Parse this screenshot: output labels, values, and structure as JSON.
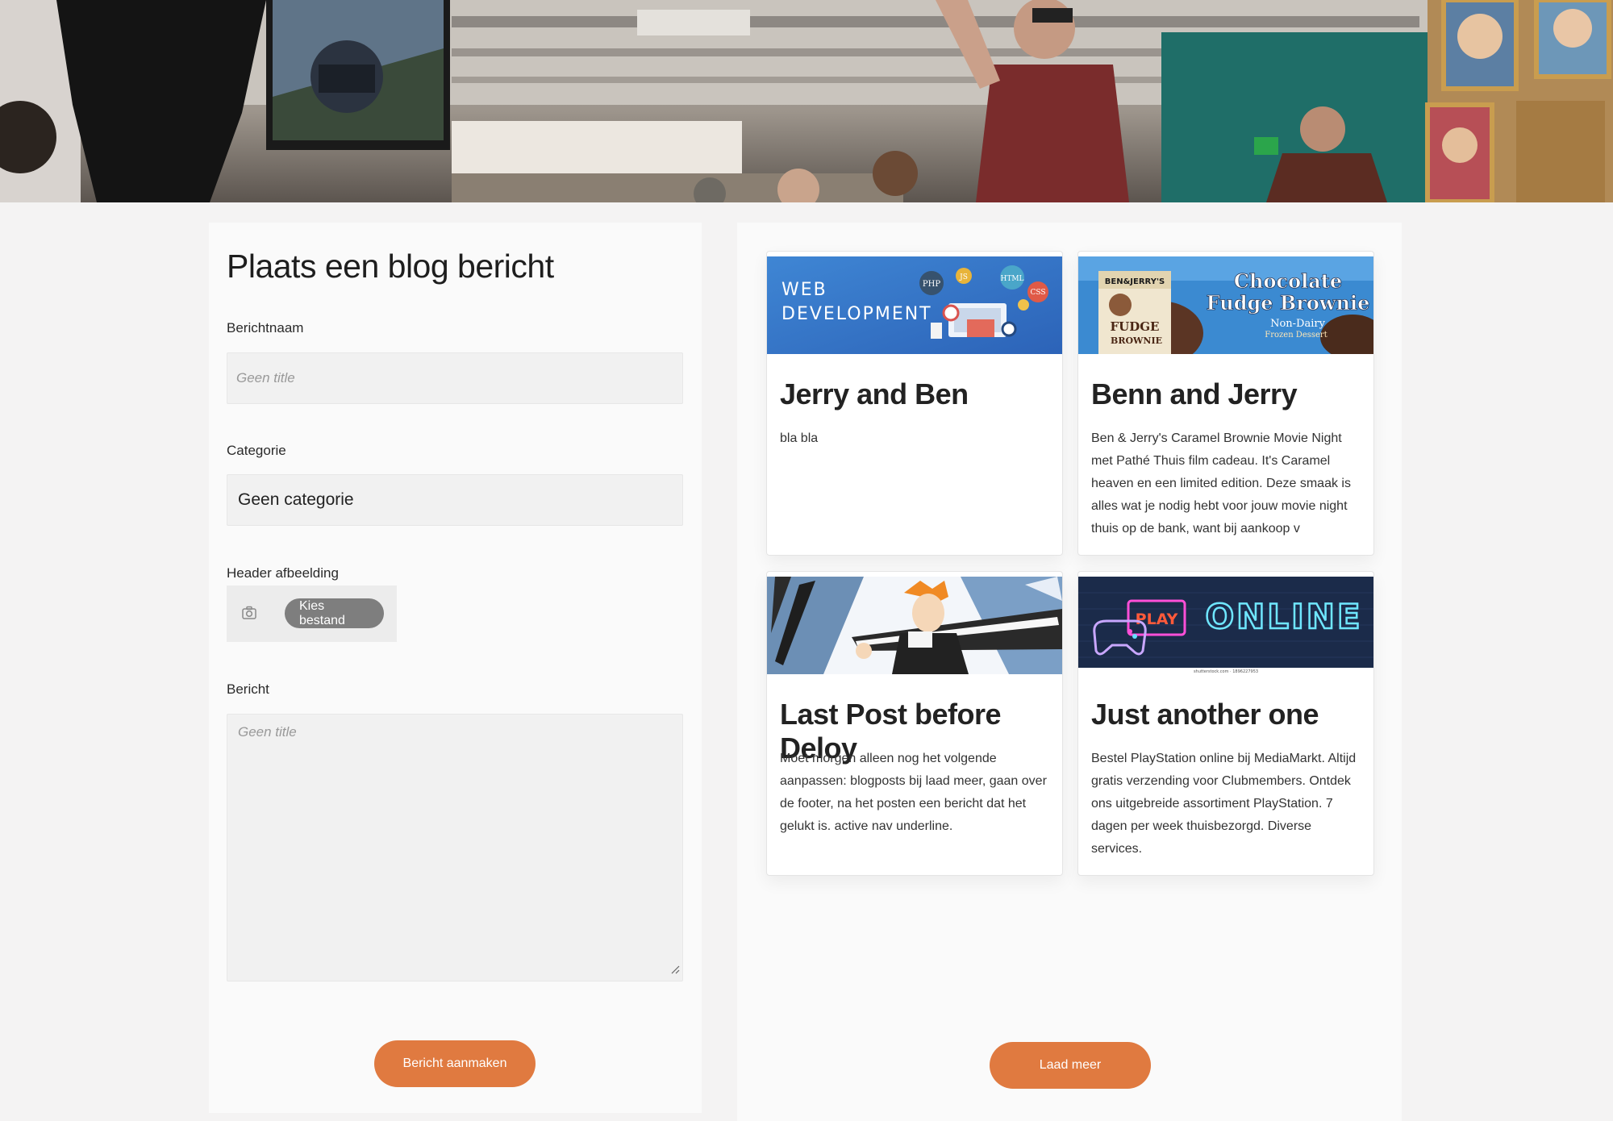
{
  "form": {
    "title": "Plaats een blog bericht",
    "name_label": "Berichtnaam",
    "name_placeholder": "Geen title",
    "category_label": "Categorie",
    "category_value": "Geen categorie",
    "image_label": "Header afbeelding",
    "file_button": "Kies bestand",
    "message_label": "Bericht",
    "message_placeholder": "Geen title",
    "submit_label": "Bericht aanmaken"
  },
  "posts": [
    {
      "title": "Jerry and Ben",
      "excerpt": "bla bla",
      "image": {
        "lines": [
          "WEB",
          "DEVELOPMENT"
        ],
        "badges": [
          "PHP",
          "JS",
          "HTML",
          "CSS"
        ]
      }
    },
    {
      "title": "Benn and Jerry",
      "excerpt": "Ben & Jerry's Caramel Brownie Movie Night met Pathé Thuis film cadeau. It's Caramel heaven en een limited edition. Deze smaak is alles wat je nodig hebt voor jouw movie night thuis op de bank, want bij aankoop v",
      "image": {
        "brand": "BEN&JERRY'S",
        "headline_1": "Chocolate",
        "headline_2": "Fudge Brownie",
        "sub": "Non-Dairy",
        "sub2": "Frozen Dessert",
        "tub_1": "FUDGE",
        "tub_2": "BROWNIE"
      }
    },
    {
      "title": "Last Post before Deloy",
      "excerpt": "Moet morgen alleen nog het volgende aanpassen: blogposts bij laad meer, gaan over de footer, na het posten een bericht dat het gelukt is. active nav underline.",
      "image": {}
    },
    {
      "title": "Just another one",
      "excerpt": "Bestel PlayStation online bij MediaMarkt. Altijd gratis verzending voor Clubmembers. Ontdek ons uitgebreide assortiment PlayStation. 7 dagen per week thuisbezorgd. Diverse services.",
      "image": {
        "play": "PLAY",
        "online": "ONLINE",
        "credit": "shutterstock.com · 1896227953"
      }
    }
  ],
  "load_more_label": "Laad meer",
  "colors": {
    "accent": "#e07a40",
    "panel": "#fafafa",
    "page": "#f4f3f3"
  }
}
